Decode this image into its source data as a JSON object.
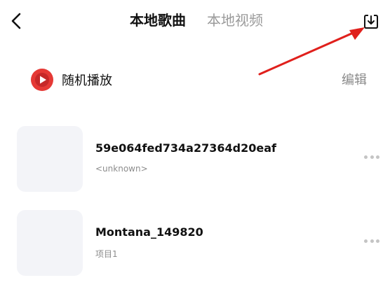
{
  "header": {
    "tabs": [
      {
        "label": "本地歌曲",
        "active": true
      },
      {
        "label": "本地视频",
        "active": false
      }
    ]
  },
  "actions": {
    "shuffle_label": "随机播放",
    "edit_label": "编辑"
  },
  "songs": [
    {
      "title": "59e064fed734a27364d20eaf",
      "subtitle": "<unknown>"
    },
    {
      "title": "Montana_149820",
      "subtitle": "项目1"
    }
  ],
  "colors": {
    "accent": "#e53935",
    "inactive_text": "#9a9a9a",
    "cover_bg": "#f3f4f8"
  },
  "icons": {
    "back": "chevron-left-icon",
    "download": "download-box-icon",
    "shuffle": "play-circle-icon",
    "more": "more-dots-icon"
  }
}
